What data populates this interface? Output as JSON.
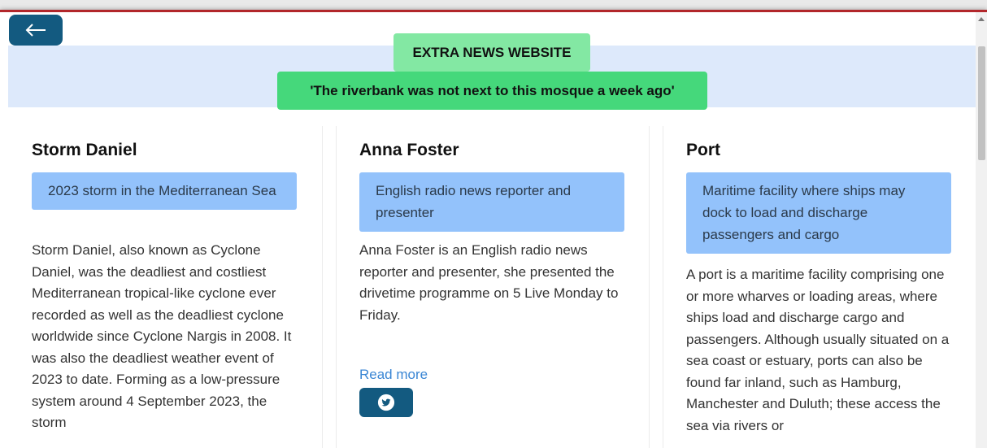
{
  "header": {
    "site_title": "EXTRA NEWS WEBSITE",
    "headline": "'The riverbank was not next to this mosque a week ago'"
  },
  "back_button": {
    "icon": "arrow-left-icon"
  },
  "cards": [
    {
      "title": "Storm Daniel",
      "summary": "2023 storm in the Mediterranean Sea",
      "body": "Storm Daniel, also known as Cyclone Daniel, was the deadliest and costliest Mediterranean tropical-like cyclone ever recorded as well as the deadliest cyclone worldwide since Cyclone Nargis in 2008. It was also the deadliest weather event of 2023 to date. Forming as a low-pressure system around 4 September 2023, the storm"
    },
    {
      "title": "Anna Foster",
      "summary": "English radio news reporter and presenter",
      "body": "Anna Foster is an English radio news reporter and presenter, she presented the drivetime programme on 5 Live Monday to Friday.",
      "read_more": "Read more",
      "share_icon": "twitter-icon"
    },
    {
      "title": "Port",
      "summary": "Maritime facility where ships may dock to load and discharge passengers and cargo",
      "body": "A port is a maritime facility comprising one or more wharves or loading areas, where ships load and discharge cargo and passengers. Although usually situated on a sea coast or estuary, ports can also be found far inland, such as Hamburg, Manchester and Duluth; these access the sea via rivers or"
    }
  ],
  "colors": {
    "accent_top": "#b2272b",
    "button": "#135a80",
    "banner": "#dde9fb",
    "title_badge": "#83e8a3",
    "headline_badge": "#45d87b",
    "summary_box": "#93c2fb",
    "link": "#3a86d4"
  }
}
